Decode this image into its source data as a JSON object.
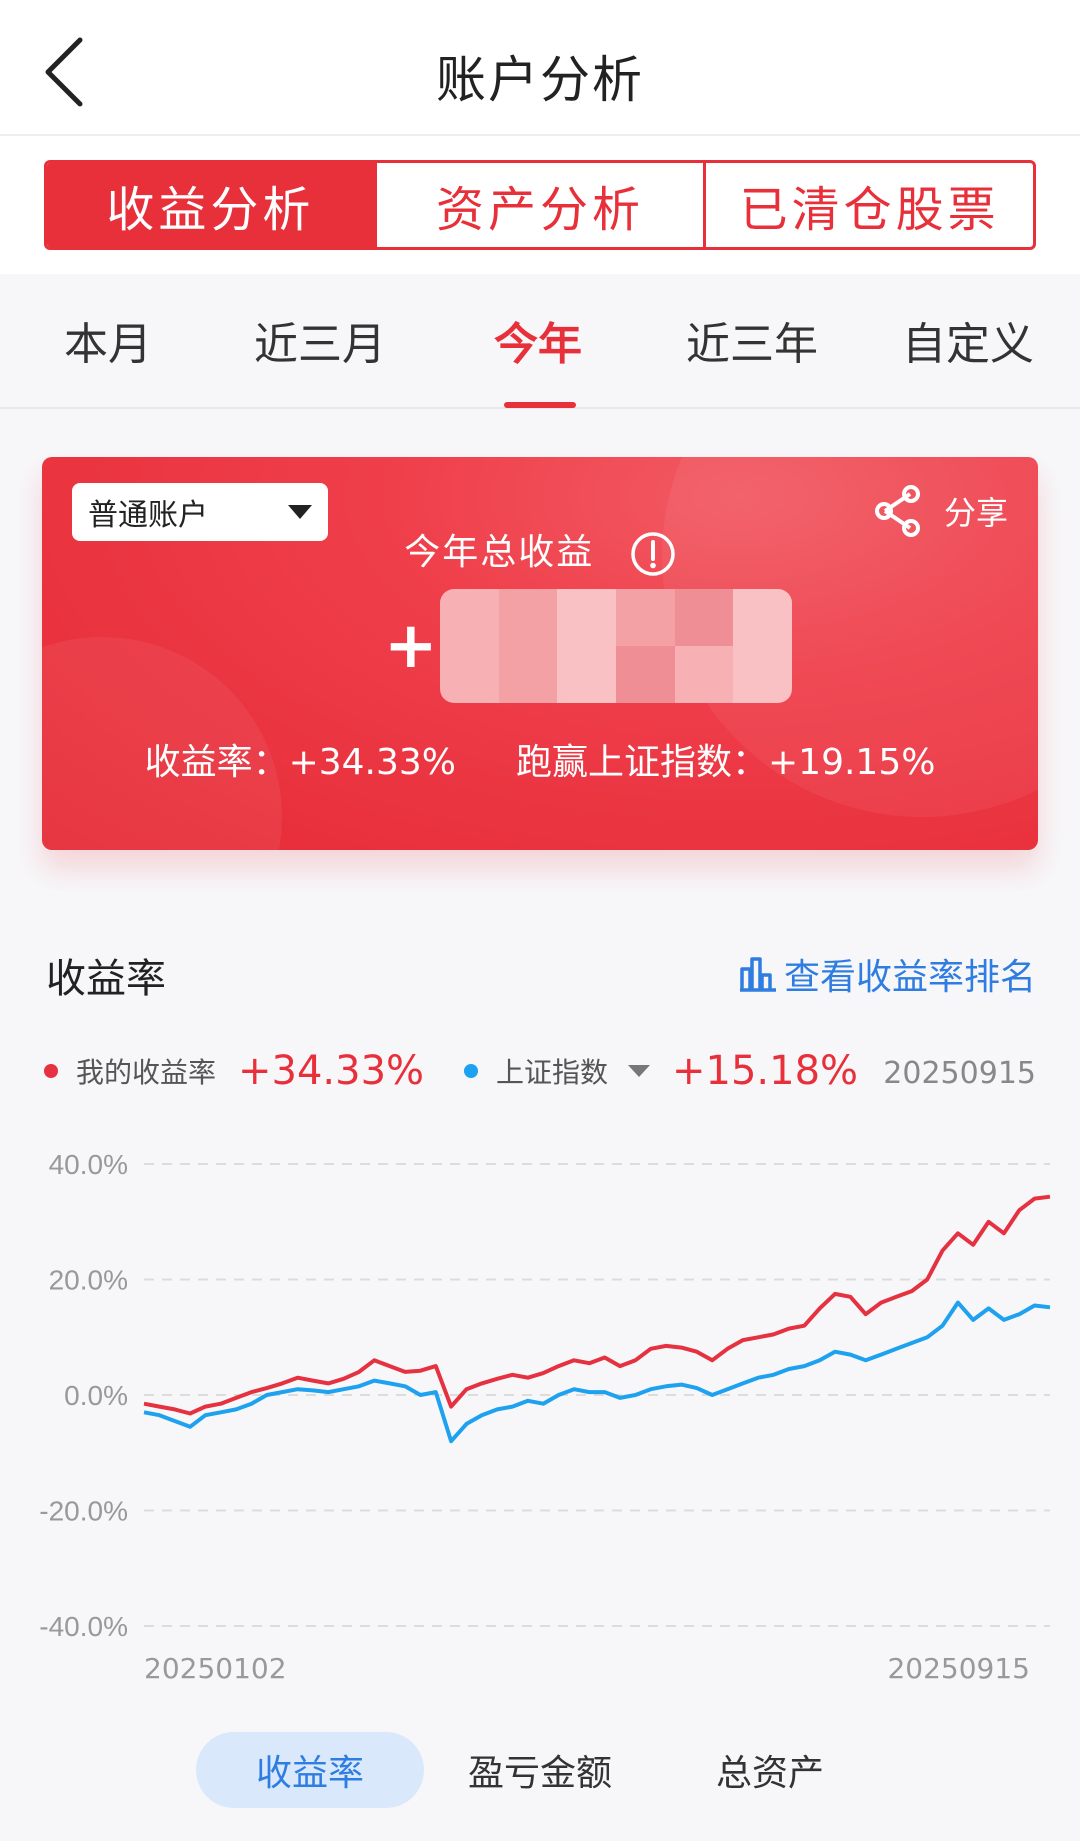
{
  "header": {
    "title": "账户分析"
  },
  "segments": [
    "收益分析",
    "资产分析",
    "已清仓股票"
  ],
  "segment_active": 0,
  "periods": [
    "本月",
    "近三月",
    "今年",
    "近三年",
    "自定义"
  ],
  "period_active": 2,
  "card": {
    "account_select": "普通账户",
    "share_label": "分享",
    "title": "今年总收益",
    "plus": "+",
    "return_rate": "收益率：+34.33%",
    "beat_index": "跑赢上证指数：+19.15%"
  },
  "section": {
    "title": "收益率",
    "ranking_link": "查看收益率排名"
  },
  "legend": {
    "mine_label": "我的收益率",
    "mine_value": "+34.33%",
    "index_label": "上证指数",
    "index_value": "+15.18%",
    "date": "20250915"
  },
  "colors": {
    "accent": "#e8303b",
    "my_line": "#e53140",
    "index_line": "#1ea1ef",
    "link": "#2f7de1"
  },
  "chart_data": {
    "type": "line",
    "y_ticks": [
      "40.0%",
      "20.0%",
      "0.0%",
      "-20.0%",
      "-40.0%"
    ],
    "ylim": [
      -40,
      40
    ],
    "x_start_label": "20250102",
    "x_end_label": "20250915",
    "grid": true,
    "series": [
      {
        "name": "我的收益率",
        "color": "#e53140",
        "values": [
          -1.5,
          -2.0,
          -2.5,
          -3.2,
          -2.0,
          -1.5,
          -0.5,
          0.5,
          1.2,
          2.0,
          3.0,
          2.5,
          2.0,
          2.8,
          4.0,
          6.0,
          5.0,
          4.0,
          4.2,
          5.0,
          -2.0,
          1.0,
          2.0,
          2.8,
          3.5,
          3.0,
          3.8,
          5.0,
          6.0,
          5.5,
          6.5,
          5.0,
          6.0,
          8.0,
          8.5,
          8.2,
          7.5,
          6.0,
          8.0,
          9.5,
          10.0,
          10.5,
          11.5,
          12.0,
          15.0,
          17.5,
          17.0,
          14.0,
          16.0,
          17.0,
          18.0,
          20.0,
          25.0,
          28.0,
          26.0,
          30.0,
          28.0,
          32.0,
          34.0,
          34.33
        ]
      },
      {
        "name": "上证指数",
        "color": "#1ea1ef",
        "values": [
          -3.0,
          -3.5,
          -4.5,
          -5.5,
          -3.5,
          -3.0,
          -2.5,
          -1.5,
          0.0,
          0.5,
          1.0,
          0.8,
          0.5,
          1.0,
          1.5,
          2.5,
          2.0,
          1.5,
          0.0,
          0.5,
          -8.0,
          -5.0,
          -3.5,
          -2.5,
          -2.0,
          -1.0,
          -1.5,
          0.0,
          1.0,
          0.5,
          0.5,
          -0.5,
          0.0,
          1.0,
          1.5,
          1.8,
          1.2,
          0.0,
          1.0,
          2.0,
          3.0,
          3.5,
          4.5,
          5.0,
          6.0,
          7.5,
          7.0,
          6.0,
          7.0,
          8.0,
          9.0,
          10.0,
          12.0,
          16.0,
          13.0,
          15.0,
          13.0,
          14.0,
          15.5,
          15.18
        ]
      }
    ]
  },
  "bottom_tabs": [
    "收益率",
    "盈亏金额",
    "总资产"
  ],
  "bottom_active": 0
}
